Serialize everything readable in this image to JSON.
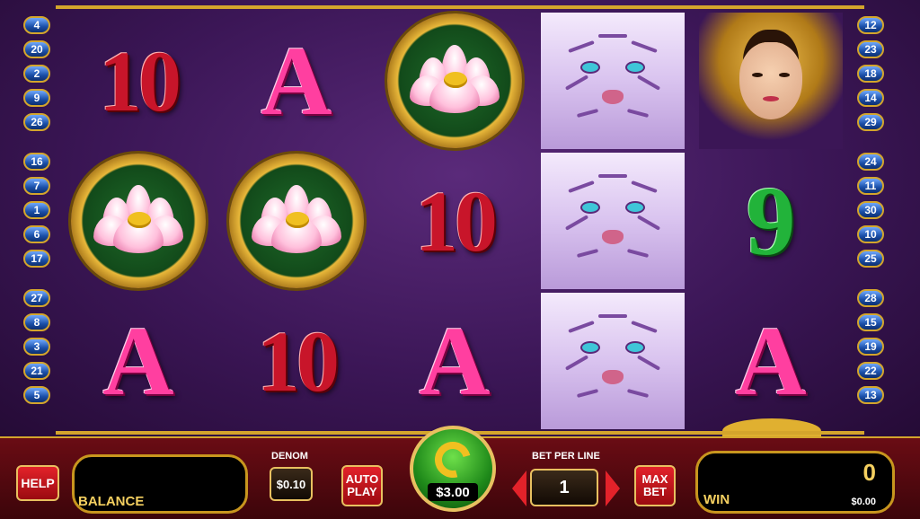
{
  "reels": [
    [
      "10",
      "lotus",
      "A"
    ],
    [
      "A",
      "lotus",
      "10"
    ],
    [
      "lotus",
      "10",
      "A"
    ],
    [
      "tiger",
      "tiger",
      "tiger"
    ],
    [
      "princess",
      "9",
      "A"
    ]
  ],
  "paylines_left": [
    "4",
    "20",
    "2",
    "9",
    "26",
    "16",
    "7",
    "1",
    "6",
    "17",
    "27",
    "8",
    "3",
    "21",
    "5"
  ],
  "paylines_right": [
    "12",
    "23",
    "18",
    "14",
    "29",
    "24",
    "11",
    "30",
    "10",
    "25",
    "28",
    "15",
    "19",
    "22",
    "13"
  ],
  "panel": {
    "help_label": "HELP",
    "balance_label": "BALANCE",
    "denom_label": "DENOM",
    "denom_value": "$0.10",
    "auto_play_label": "AUTO PLAY",
    "spin_bet": "$3.00",
    "bet_per_line_label": "BET PER LINE",
    "bet_per_line_value": "1",
    "max_bet_label": "MAX BET",
    "win_label": "WIN",
    "win_credits": "0",
    "win_amount": "$0.00"
  },
  "colors": {
    "gold": "#d4a52c",
    "panel_red": "#6a0c14",
    "payline_blue": "#1a4fa8",
    "spin_green": "#1f8a1a"
  },
  "icons": {
    "spin": "refresh-arrow-icon",
    "bet_down": "triangle-left-icon",
    "bet_up": "triangle-right-icon"
  }
}
